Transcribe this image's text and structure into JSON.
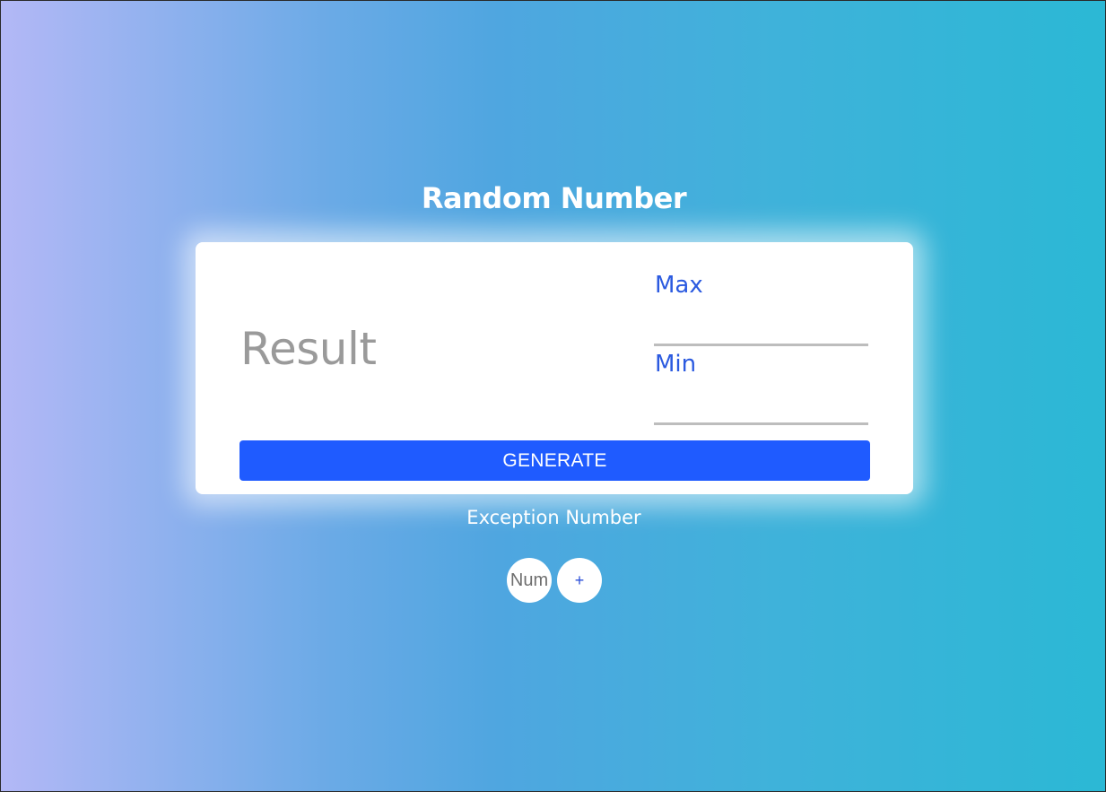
{
  "app": {
    "title": "Random Number"
  },
  "card": {
    "result_text": "Result",
    "max": {
      "placeholder": "Max",
      "value": ""
    },
    "min": {
      "placeholder": "Min",
      "value": ""
    },
    "generate_label": "GENERATE"
  },
  "exception": {
    "label": "Exception Number",
    "input_placeholder": "Num",
    "add_label": "+"
  },
  "colors": {
    "accent": "#1f5bff",
    "field_text": "#2b5ae0",
    "result_text": "#9a9a9a",
    "gradient_start": "#b3b8f6",
    "gradient_end": "#2bb8d5"
  }
}
